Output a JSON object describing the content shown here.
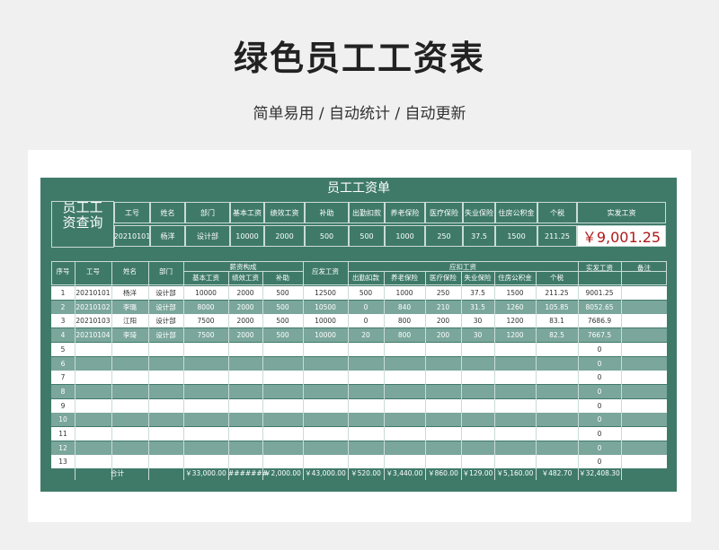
{
  "page": {
    "title": "绿色员工工资表",
    "subtitle": "简单易用 / 自动统计 / 自动更新"
  },
  "sheet": {
    "title": "员工工资单",
    "query": {
      "label": "员工工资查询",
      "headers": [
        "工号",
        "姓名",
        "部门",
        "基本工资",
        "绩效工资",
        "补助",
        "出勤扣款",
        "养老保险",
        "医疗保险",
        "失业保险",
        "住房公积金",
        "个税",
        "实发工资"
      ],
      "values": [
        "20210101",
        "杨洋",
        "设计部",
        "10000",
        "2000",
        "500",
        "500",
        "1000",
        "250",
        "37.5",
        "1500",
        "211.25",
        "￥9,001.25"
      ]
    },
    "table": {
      "headers": {
        "seq": "序号",
        "id": "工号",
        "name": "姓名",
        "dept": "部门",
        "salary_group": "薪资构成",
        "base": "基本工资",
        "perf": "绩效工资",
        "subsidy": "补助",
        "gross": "应发工资",
        "deduct_group": "应扣工资",
        "absence": "出勤扣款",
        "pension": "养老保险",
        "medical": "医疗保险",
        "unemployment": "失业保险",
        "housing": "住房公积金",
        "tax": "个税",
        "net": "实发工资",
        "remark": "备注"
      },
      "rows": [
        [
          "1",
          "20210101",
          "杨洋",
          "设计部",
          "10000",
          "2000",
          "500",
          "12500",
          "500",
          "1000",
          "250",
          "37.5",
          "1500",
          "211.25",
          "9001.25",
          ""
        ],
        [
          "2",
          "20210102",
          "李璐",
          "设计部",
          "8000",
          "2000",
          "500",
          "10500",
          "0",
          "840",
          "210",
          "31.5",
          "1260",
          "105.85",
          "8052.65",
          ""
        ],
        [
          "3",
          "20210103",
          "江阳",
          "设计部",
          "7500",
          "2000",
          "500",
          "10000",
          "0",
          "800",
          "200",
          "30",
          "1200",
          "83.1",
          "7686.9",
          ""
        ],
        [
          "4",
          "20210104",
          "李琦",
          "设计部",
          "7500",
          "2000",
          "500",
          "10000",
          "20",
          "800",
          "200",
          "30",
          "1200",
          "82.5",
          "7667.5",
          ""
        ],
        [
          "5",
          "",
          "",
          "",
          "",
          "",
          "",
          "",
          "",
          "",
          "",
          "",
          "",
          "",
          "0",
          ""
        ],
        [
          "6",
          "",
          "",
          "",
          "",
          "",
          "",
          "",
          "",
          "",
          "",
          "",
          "",
          "",
          "0",
          ""
        ],
        [
          "7",
          "",
          "",
          "",
          "",
          "",
          "",
          "",
          "",
          "",
          "",
          "",
          "",
          "",
          "0",
          ""
        ],
        [
          "8",
          "",
          "",
          "",
          "",
          "",
          "",
          "",
          "",
          "",
          "",
          "",
          "",
          "",
          "0",
          ""
        ],
        [
          "9",
          "",
          "",
          "",
          "",
          "",
          "",
          "",
          "",
          "",
          "",
          "",
          "",
          "",
          "0",
          ""
        ],
        [
          "10",
          "",
          "",
          "",
          "",
          "",
          "",
          "",
          "",
          "",
          "",
          "",
          "",
          "",
          "0",
          ""
        ],
        [
          "11",
          "",
          "",
          "",
          "",
          "",
          "",
          "",
          "",
          "",
          "",
          "",
          "",
          "",
          "0",
          ""
        ],
        [
          "12",
          "",
          "",
          "",
          "",
          "",
          "",
          "",
          "",
          "",
          "",
          "",
          "",
          "",
          "0",
          ""
        ],
        [
          "13",
          "",
          "",
          "",
          "",
          "",
          "",
          "",
          "",
          "",
          "",
          "",
          "",
          "",
          "0",
          ""
        ]
      ],
      "totals": {
        "label": "合计",
        "values": [
          "￥33,000.00",
          "#######",
          "￥2,000.00",
          "￥43,000.00",
          "￥520.00",
          "￥3,440.00",
          "￥860.00",
          "￥129.00",
          "￥5,160.00",
          "￥482.70",
          "￥32,408.30"
        ]
      }
    }
  },
  "colors": {
    "sheet_green": "#3f7a69",
    "row_green": "#7aa69b",
    "accent_red": "#b01818"
  }
}
